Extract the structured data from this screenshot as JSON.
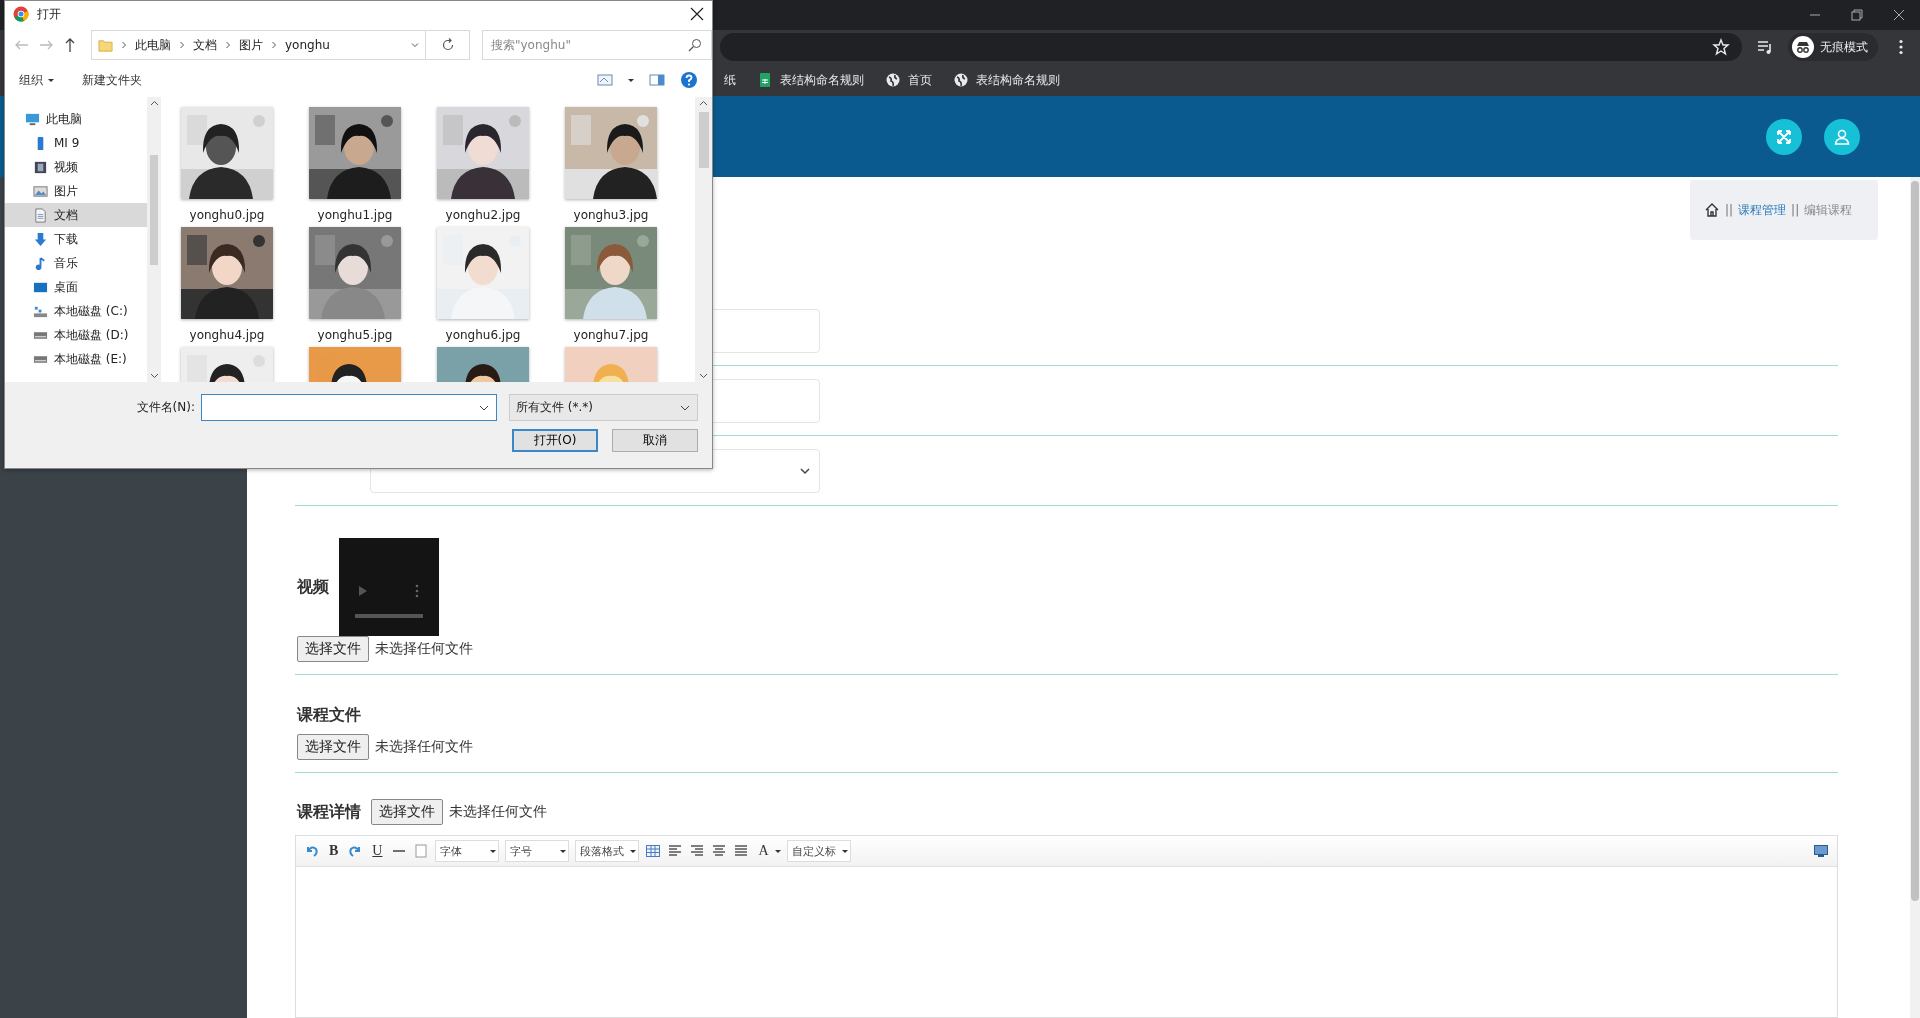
{
  "browser": {
    "bookmarks": [
      {
        "label": "纸",
        "kind": "plain"
      },
      {
        "label": "表结构命名规则",
        "kind": "sheet"
      },
      {
        "label": "首页",
        "kind": "globe"
      },
      {
        "label": "表结构命名规则",
        "kind": "globe"
      }
    ],
    "profile": "无痕模式"
  },
  "page": {
    "breadcrumb": [
      {
        "prefix": "||",
        "label": "课程管理",
        "kind": "link"
      },
      {
        "prefix": "||",
        "label": "编辑课程",
        "kind": "current"
      }
    ],
    "fields": [
      {
        "kind": "input"
      },
      {
        "kind": "input"
      },
      {
        "kind": "select"
      }
    ],
    "uploads": [
      {
        "label": "视频",
        "kind": "video",
        "button": "选择文件",
        "status": "未选择任何文件"
      },
      {
        "label": "课程文件",
        "kind": "file",
        "button": "选择文件",
        "status": "未选择任何文件"
      },
      {
        "label": "课程详情",
        "kind": "inline",
        "button": "选择文件",
        "status": "未选择任何文件"
      }
    ],
    "editor": {
      "tools": [
        {
          "kind": "undo"
        },
        {
          "kind": "bold",
          "text": "B"
        },
        {
          "kind": "redo"
        },
        {
          "kind": "underline",
          "text": "U"
        },
        {
          "kind": "hr"
        },
        {
          "kind": "square"
        },
        {
          "kind": "dropdown",
          "text": "字体"
        },
        {
          "kind": "dropdown",
          "text": "字号"
        },
        {
          "kind": "dropdown",
          "text": "段落格式"
        },
        {
          "kind": "table"
        },
        {
          "kind": "alignleft"
        },
        {
          "kind": "alignright"
        },
        {
          "kind": "aligncenter"
        },
        {
          "kind": "justify"
        },
        {
          "kind": "color",
          "text": "A"
        },
        {
          "kind": "dropdown",
          "text": "自定义标"
        }
      ]
    }
  },
  "dialog": {
    "title": "打开",
    "path": [
      "此电脑",
      "文档",
      "图片",
      "yonghu"
    ],
    "search": {
      "placeholder": "搜索\"yonghu\""
    },
    "toolbar": {
      "organize": "组织",
      "new_folder": "新建文件夹"
    },
    "tree": [
      {
        "label": "此电脑",
        "kind": "pc",
        "selected": false,
        "children": [
          {
            "label": "MI 9",
            "kind": "phone",
            "selected": false
          },
          {
            "label": "视频",
            "kind": "video",
            "selected": false
          },
          {
            "label": "图片",
            "kind": "pictures",
            "selected": false
          },
          {
            "label": "文档",
            "kind": "documents",
            "selected": true
          },
          {
            "label": "下载",
            "kind": "download",
            "selected": false
          },
          {
            "label": "音乐",
            "kind": "music",
            "selected": false
          },
          {
            "label": "桌面",
            "kind": "desktop",
            "selected": false
          },
          {
            "label": "本地磁盘 (C:)",
            "kind": "systemdrive",
            "selected": false
          },
          {
            "label": "本地磁盘 (D:)",
            "kind": "drive",
            "selected": false
          },
          {
            "label": "本地磁盘 (E:)",
            "kind": "drive",
            "selected": false
          }
        ]
      }
    ],
    "files": [
      {
        "kind": "picture",
        "name": "yonghu0.jpg"
      },
      {
        "kind": "picture",
        "name": "yonghu1.jpg"
      },
      {
        "kind": "picture",
        "name": "yonghu2.jpg"
      },
      {
        "kind": "picture",
        "name": "yonghu3.jpg"
      },
      {
        "kind": "picture",
        "name": "yonghu4.jpg"
      },
      {
        "kind": "picture",
        "name": "yonghu5.jpg"
      },
      {
        "kind": "picture",
        "name": "yonghu6.jpg"
      },
      {
        "kind": "picture",
        "name": "yonghu7.jpg"
      },
      {
        "kind": "picture"
      },
      {
        "kind": "picture"
      },
      {
        "kind": "picture"
      },
      {
        "kind": "picture"
      }
    ],
    "filename_label": "文件名(N):",
    "filter": "所有文件 (*.*)",
    "buttons": [
      {
        "label": "打开(O)",
        "kind": "primary"
      },
      {
        "label": "取消",
        "kind": "normal"
      }
    ]
  }
}
